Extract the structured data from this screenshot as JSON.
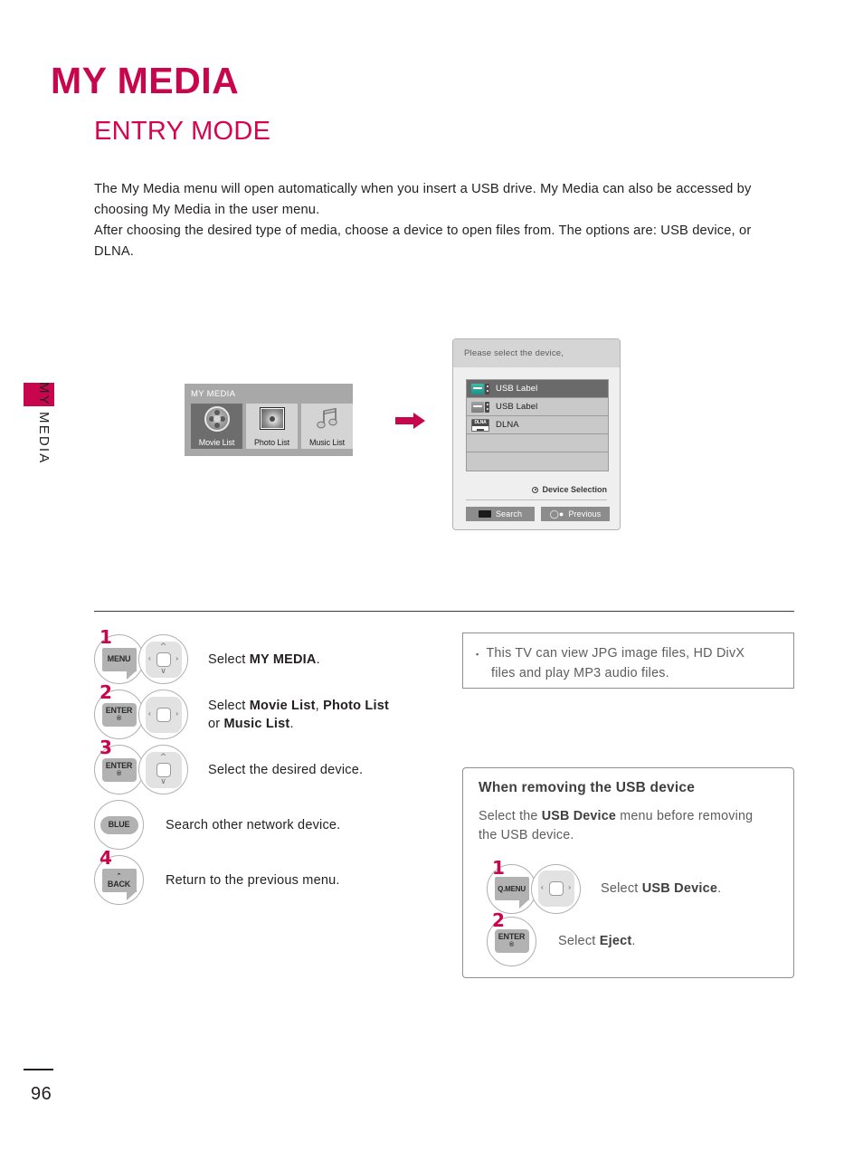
{
  "colors": {
    "accent": "#c8064e",
    "section_heading": "#d3064f",
    "body_text": "#231f20",
    "muted_text": "#5d5d5d",
    "usb_icon_active": "#3fb9ae"
  },
  "sidebar": {
    "tab_label": "MY MEDIA"
  },
  "header": {
    "page_title": "MY MEDIA",
    "section_title": "ENTRY MODE"
  },
  "intro": {
    "paragraph_1": "The My Media menu will open automatically when you insert a USB drive. My Media can also be accessed by choosing My Media in the user menu.",
    "paragraph_2": "After choosing the desired type of media, choose a device to open files from. The options are: USB device, or DLNA."
  },
  "tv_screen": {
    "title": "MY MEDIA",
    "tiles": [
      {
        "label": "Movie List",
        "icon": "film-reel-icon",
        "selected": true
      },
      {
        "label": "Photo List",
        "icon": "photo-icon",
        "selected": false
      },
      {
        "label": "Music List",
        "icon": "music-note-icon",
        "selected": false
      }
    ]
  },
  "arrow": {
    "icon": "arrow-right-icon"
  },
  "device_dialog": {
    "header": "Please select the device,",
    "rows": [
      {
        "label": "USB Label",
        "icon": "usb-icon",
        "selected": true
      },
      {
        "label": "USB Label",
        "icon": "usb-icon",
        "selected": false
      },
      {
        "label": "DLNA",
        "icon": "dlna-icon",
        "selected": false
      },
      {
        "label": "",
        "icon": "",
        "selected": false
      },
      {
        "label": "",
        "icon": "",
        "selected": false
      }
    ],
    "hint": "Device Selection",
    "buttons": [
      {
        "label": "Search",
        "icon": "blue-key-icon"
      },
      {
        "label": "Previous",
        "icon": "back-key-icon"
      }
    ]
  },
  "steps": [
    {
      "number": "1",
      "keys": [
        {
          "type": "folded",
          "label": "MENU"
        },
        {
          "type": "dpad",
          "arrows": [
            "up",
            "down",
            "left",
            "right"
          ]
        }
      ],
      "text_html": "Select <b>MY MEDIA</b>."
    },
    {
      "number": "2",
      "keys": [
        {
          "type": "rounded",
          "label": "ENTER",
          "sub": "®"
        },
        {
          "type": "dpad",
          "arrows": [
            "left",
            "right"
          ]
        }
      ],
      "text_html": "Select <b>Movie List</b>, <b>Photo List</b><br>or <b>Music List</b>."
    },
    {
      "number": "3",
      "keys": [
        {
          "type": "rounded",
          "label": "ENTER",
          "sub": "®"
        },
        {
          "type": "dpad",
          "arrows": [
            "up",
            "down"
          ]
        }
      ],
      "text_html": "Select the desired device."
    },
    {
      "number": "",
      "keys": [
        {
          "type": "pill",
          "label": "BLUE"
        }
      ],
      "text_html": "Search other network device."
    },
    {
      "number": "4",
      "keys": [
        {
          "type": "folded",
          "label": "BACK",
          "sub": "⌃"
        }
      ],
      "text_html": "Return to the previous menu."
    }
  ],
  "note_box": {
    "bullet": "▪",
    "line_1": "This TV can view JPG image files, HD DivX",
    "line_2": "files and play MP3 audio files."
  },
  "usb_box": {
    "title": "When removing the USB device",
    "description_html": "Select the <b>USB Device</b> menu before removing the USB device.",
    "steps": [
      {
        "number": "1",
        "keys": [
          {
            "type": "folded",
            "label": "Q.MENU"
          },
          {
            "type": "dpad",
            "arrows": [
              "left",
              "right"
            ]
          }
        ],
        "text_html": "Select <b>USB Device</b>."
      },
      {
        "number": "2",
        "keys": [
          {
            "type": "rounded",
            "label": "ENTER",
            "sub": "®"
          }
        ],
        "text_html": "Select <b>Eject</b>."
      }
    ]
  },
  "footer": {
    "page_number": "96"
  }
}
